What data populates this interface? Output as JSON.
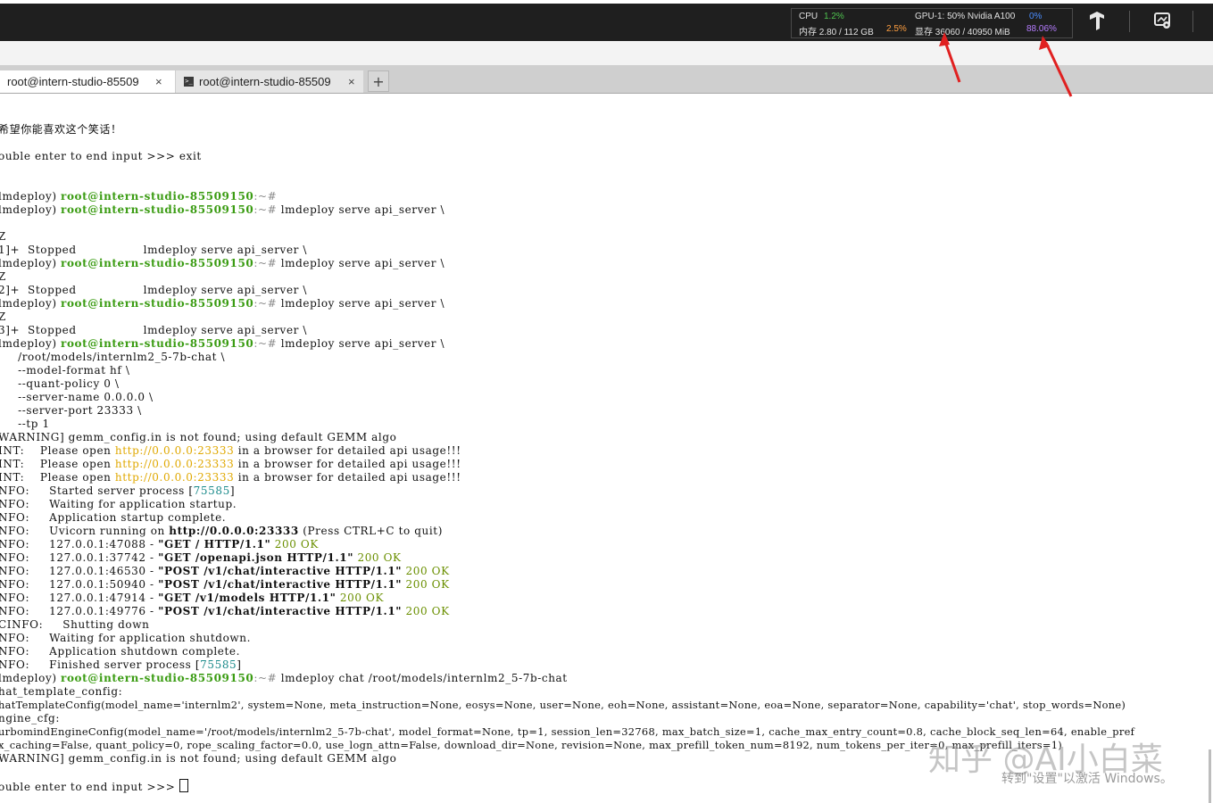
{
  "monitor": {
    "cpu_label": "CPU",
    "cpu_value": "1.2%",
    "mem_label": "内存 2.80 / 112 GB",
    "mem_value": "2.5%",
    "gpu_label": "GPU-1: 50% Nvidia A100",
    "gpu_value": "0%",
    "vram_label": "显存 36060 / 40950 MiB",
    "vram_value": "88.06%",
    "colors": {
      "cpu": "#4fc34f",
      "mem": "#ff9f40",
      "gpu": "#4a8cff",
      "vram": "#b57cff",
      "arrow": "#e02020"
    }
  },
  "toolbar": {
    "icons": [
      "tensorflow-icon",
      "settings-monitor-icon"
    ]
  },
  "tabs": [
    {
      "label": "root@intern-studio-85509",
      "close": "×",
      "active": true
    },
    {
      "label": "root@intern-studio-85509",
      "close": "×",
      "active": false
    }
  ],
  "new_tab": "+",
  "terminal": {
    "l1": "希望你能喜欢这个笑话！",
    "l2": "ouble enter to end input >>> exit",
    "p_prefix": "lmdeploy) ",
    "prompt_user": "root@intern-studio-85509150",
    "prompt_sep": ":~#",
    "l3_cmd": "",
    "serve_cmd": " lmdeploy serve api_server \\",
    "ctrlz": "Z",
    "stop1": "1]+  Stopped                 lmdeploy serve api_server \\",
    "stop2": "2]+  Stopped                 lmdeploy serve api_server \\",
    "stop3": "3]+  Stopped                 lmdeploy serve api_server \\",
    "arg1": "     /root/models/internlm2_5-7b-chat \\",
    "arg2": "     --model-format hf \\",
    "arg3": "     --quant-policy 0 \\",
    "arg4": "     --server-name 0.0.0.0 \\",
    "arg5": "     --server-port 23333 \\",
    "arg6": "     --tp 1",
    "warn1": "WARNING] gemm_config.in is not found; using default GEMM algo",
    "hint_prefix": "INT:    Please open ",
    "hint_url": "http://0.0.0.0:23333",
    "hint_suffix": " in a browser for detailed api usage!!!",
    "started_prefix": "NFO:     Started server process [",
    "pid": "75585",
    "close_bracket": "]",
    "waiting": "NFO:     Waiting for application startup.",
    "startup": "NFO:     Application startup complete.",
    "uvicorn_prefix": "NFO:     Uvicorn running on ",
    "uvicorn_url": "http://0.0.0.0:23333",
    "uvicorn_suffix": " (Press CTRL+C to quit)",
    "req1_addr": "NFO:     127.0.0.1:47088 - ",
    "req1_req": "\"GET / HTTP/1.1\"",
    "req2_addr": "NFO:     127.0.0.1:37742 - ",
    "req2_req": "\"GET /openapi.json HTTP/1.1\"",
    "req3_addr": "NFO:     127.0.0.1:46530 - ",
    "req3_req": "\"POST /v1/chat/interactive HTTP/1.1\"",
    "req4_addr": "NFO:     127.0.0.1:50940 - ",
    "req4_req": "\"POST /v1/chat/interactive HTTP/1.1\"",
    "req5_addr": "NFO:     127.0.0.1:47914 - ",
    "req5_req": "\"GET /v1/models HTTP/1.1\"",
    "req6_addr": "NFO:     127.0.0.1:49776 - ",
    "req6_req": "\"POST /v1/chat/interactive HTTP/1.1\"",
    "status_ok": " 200 OK",
    "shutting": "CINFO:     Shutting down",
    "wait_shutdown": "NFO:     Waiting for application shutdown.",
    "shutdown_complete": "NFO:     Application shutdown complete.",
    "finished_prefix": "NFO:     Finished server process [",
    "chat_cmd": " lmdeploy chat /root/models/internlm2_5-7b-chat",
    "chat_template": "hat_template_config:",
    "chat_template_val": "hatTemplateConfig(model_name='internlm2', system=None, meta_instruction=None, eosys=None, user=None, eoh=None, assistant=None, eoa=None, separator=None, capability='chat', stop_words=None)",
    "engine_cfg": "ngine_cfg:",
    "engine_val1": "urbomindEngineConfig(model_name='/root/models/internlm2_5-7b-chat', model_format=None, tp=1, session_len=32768, max_batch_size=1, cache_max_entry_count=0.8, cache_block_seq_len=64, enable_pref",
    "engine_val2": "x_caching=False, quant_policy=0, rope_scaling_factor=0.0, use_logn_attn=False, download_dir=None, revision=None, max_prefill_token_num=8192, num_tokens_per_iter=0, max_prefill_iters=1)",
    "warn2": "WARNING] gemm_config.in is not found; using default GEMM algo",
    "final": "ouble enter to end input >>> "
  },
  "watermark": "知乎 @AI小白菜",
  "activate_text": "转到\"设置\"以激活 Windows。"
}
